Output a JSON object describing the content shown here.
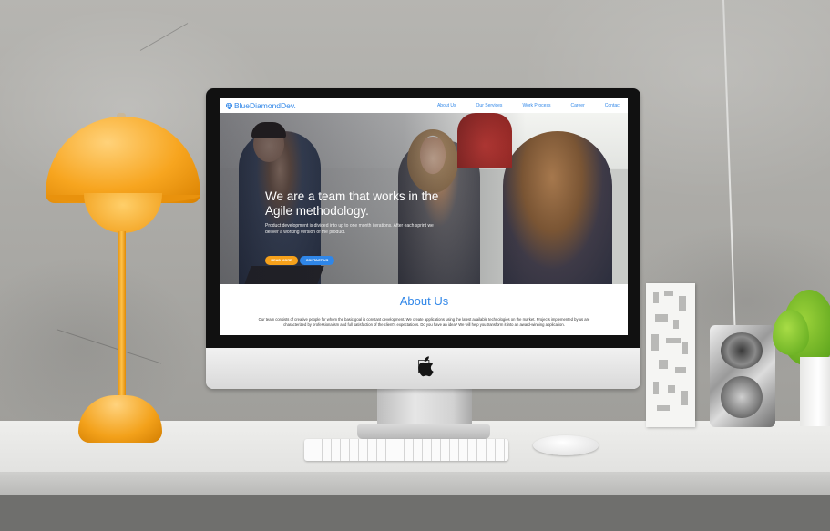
{
  "site": {
    "logo_text": "BlueDiamondDev.",
    "nav": [
      "About Us",
      "Our Services",
      "Work Process",
      "Career",
      "Contact"
    ],
    "hero": {
      "title": "We are a team that works in the Agile methodology.",
      "text": "Product development is divided into up to one month iterations. After each sprint we deliver a working version of the product.",
      "read_more": "READ MORE",
      "contact_us": "CONTACT US"
    },
    "about": {
      "title": "About Us",
      "text": "Our team consists of creative people for whom the basic goal is constant development. We create applications using the latest available technologies on the market. Projects implemented by us are characterized by professionalism and full satisfaction of the client's expectations. Do you have an idea? We will help you transform it into an award-winning application."
    }
  },
  "colors": {
    "brand_blue": "#2f86e8",
    "accent_orange": "#f6a11b",
    "lamp_orange": "#f7a51f"
  },
  "icons": {
    "logo": "diamond-icon",
    "device_logo": "apple-logo-icon"
  }
}
